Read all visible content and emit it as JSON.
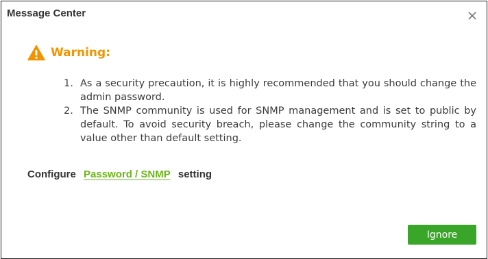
{
  "dialog": {
    "title": "Message Center",
    "close_icon": "close-icon"
  },
  "warning": {
    "icon": "warning-triangle-icon",
    "title": "Warning:",
    "color": "#f29400",
    "items": [
      {
        "number": "1.",
        "text": "As a security precaution, it is highly recommended that you should change the admin password."
      },
      {
        "number": "2.",
        "text": "The SNMP community is used for SNMP management and is set to public by default. To avoid security breach, please change the community string to a value other than default setting."
      }
    ]
  },
  "configure": {
    "prefix": "Configure",
    "link_label": "Password / SNMP",
    "suffix": "setting",
    "link_color": "#6eb51c"
  },
  "actions": {
    "ignore_label": "Ignore",
    "button_color": "#3aa629"
  }
}
